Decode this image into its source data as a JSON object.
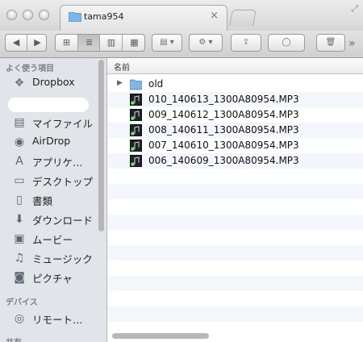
{
  "window": {
    "tab_title": "tama954",
    "tab_close": "×",
    "resize_glyph": "⤢",
    "traffic_lights": [
      "close",
      "minimize",
      "zoom"
    ]
  },
  "toolbar": {
    "back": "◀",
    "forward": "▶",
    "view_icons": "⊞",
    "view_list": "≣",
    "view_columns": "▥",
    "view_coverflow": "▦",
    "arrange": "▤ ▾",
    "action": "⚙ ▾",
    "share": "⇪",
    "label": "◯",
    "trash": "🗑",
    "overflow": "»"
  },
  "sidebar": {
    "favorites_heading": "よく使う項目",
    "devices_heading": "デバイス",
    "shared_heading": "共有",
    "items": [
      {
        "label": "Dropbox",
        "icon": "dropbox-icon",
        "glyph": "❖"
      },
      {
        "label": "",
        "icon": "redacted"
      },
      {
        "label": "マイファイル",
        "icon": "all-my-files-icon",
        "glyph": "▤"
      },
      {
        "label": "AirDrop",
        "icon": "airdrop-icon",
        "glyph": "◉"
      },
      {
        "label": "アプリケ…",
        "icon": "applications-icon",
        "glyph": "A"
      },
      {
        "label": "デスクトップ",
        "icon": "desktop-icon",
        "glyph": "▭"
      },
      {
        "label": "書類",
        "icon": "documents-icon",
        "glyph": "▯"
      },
      {
        "label": "ダウンロード",
        "icon": "downloads-icon",
        "glyph": "⬇"
      },
      {
        "label": "ムービー",
        "icon": "movies-icon",
        "glyph": "▣"
      },
      {
        "label": "ミュージック",
        "icon": "music-icon",
        "glyph": "♫"
      },
      {
        "label": "ピクチャ",
        "icon": "pictures-icon",
        "glyph": "◙"
      }
    ],
    "devices": [
      {
        "label": "リモート…",
        "icon": "remote-disc-icon",
        "glyph": "◎"
      }
    ]
  },
  "list": {
    "column_name": "名前",
    "rows": [
      {
        "name": "old",
        "type": "folder"
      },
      {
        "name": "010_140613_1300A80954.MP3",
        "type": "mp3"
      },
      {
        "name": "009_140612_1300A80954.MP3",
        "type": "mp3"
      },
      {
        "name": "008_140611_1300A80954.MP3",
        "type": "mp3"
      },
      {
        "name": "007_140610_1300A80954.MP3",
        "type": "mp3"
      },
      {
        "name": "006_140609_1300A80954.MP3",
        "type": "mp3"
      }
    ]
  },
  "colors": {
    "folder_blue": "#7fb6e6",
    "sidebar_bg": "#e1e5ea",
    "row_alt": "#f3f6fa"
  }
}
